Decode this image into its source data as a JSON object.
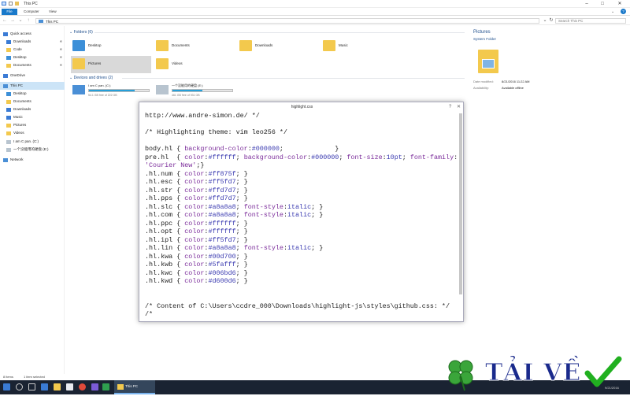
{
  "window": {
    "title": "This PC"
  },
  "ribbon": {
    "tabs": [
      "File",
      "Computer",
      "View"
    ]
  },
  "address": {
    "path": "This PC",
    "search_placeholder": "Search This PC"
  },
  "nav": {
    "items": [
      {
        "label": "Quick access",
        "pinned": false
      },
      {
        "label": "Downloads",
        "pinned": true
      },
      {
        "label": "Code",
        "pinned": true
      },
      {
        "label": "Desktop",
        "pinned": true
      },
      {
        "label": "Documents",
        "pinned": true
      },
      {
        "label": "OneDrive",
        "pinned": false
      },
      {
        "label": "This PC",
        "pinned": false
      },
      {
        "label": "Desktop",
        "pinned": false
      },
      {
        "label": "Documents",
        "pinned": false
      },
      {
        "label": "Downloads",
        "pinned": false
      },
      {
        "label": "Music",
        "pinned": false
      },
      {
        "label": "Pictures",
        "pinned": false
      },
      {
        "label": "Videos",
        "pinned": false
      },
      {
        "label": "I am C pan. (C:)",
        "pinned": false
      },
      {
        "label": "一个没能用的硬盘 (E:)",
        "pinned": false
      },
      {
        "label": "Network",
        "pinned": false
      }
    ],
    "pin_glyph": "✱"
  },
  "folders": {
    "header": "Folders (6)",
    "items": [
      "Desktop",
      "Documents",
      "Downloads",
      "Music",
      "Pictures",
      "Videos"
    ]
  },
  "drives": {
    "header": "Devices and drives (2)",
    "items": [
      {
        "label": "I am C pan. (C:)",
        "space": "54.1 GB free of 222 GB",
        "used_fraction": 0.76
      },
      {
        "label": "一个没能用的硬盘 (E:)",
        "space": "461 GB free of 931 GB",
        "used_fraction": 0.5
      }
    ]
  },
  "details": {
    "title": "Pictures",
    "subtitle": "System Folder",
    "date_label": "Date modified:",
    "date_value": "8/21/2016 11:22 AM",
    "avail_label": "Availability:",
    "avail_value": "Available offline"
  },
  "code_window": {
    "title": "highlight.css",
    "lines": [
      "http://www.andre-simon.de/ */",
      "",
      "/* Highlighting theme: vim leo256 */",
      "",
      "body.hl { background-color:#000000;             }",
      "pre.hl  { color:#ffffff; background-color:#000000; font-size:10pt; font-family:",
      "'Courier New';}",
      ".hl.num { color:#ff875f; }",
      ".hl.esc { color:#ff5fd7; }",
      ".hl.str { color:#ffd7d7; }",
      ".hl.pps { color:#ffd7d7; }",
      ".hl.slc { color:#a8a8a8; font-style:italic; }",
      ".hl.com { color:#a8a8a8; font-style:italic; }",
      ".hl.ppc { color:#ffffff; }",
      ".hl.opt { color:#ffffff; }",
      ".hl.ipl { color:#ff5fd7; }",
      ".hl.lin { color:#a8a8a8; font-style:italic; }",
      ".hl.kwa { color:#00d700; }",
      ".hl.kwb { color:#5fafff; }",
      ".hl.kwc { color:#006bd6; }",
      ".hl.kwd { color:#d600d6; }",
      "",
      "",
      "/* Content of C:\\Users\\ccdre_000\\Downloads\\highlight-js\\styles\\github.css: */",
      "/*"
    ]
  },
  "status": {
    "items_count": "8 items",
    "selected": "1 item selected"
  },
  "taskbar": {
    "active_label": "This PC",
    "clock": "9/21/2016"
  },
  "watermark": {
    "text": "TẢI VỀ"
  },
  "colors": {
    "accent": "#1979ca",
    "drive_fill": "#26a0da",
    "folder": "#f3c94d"
  }
}
